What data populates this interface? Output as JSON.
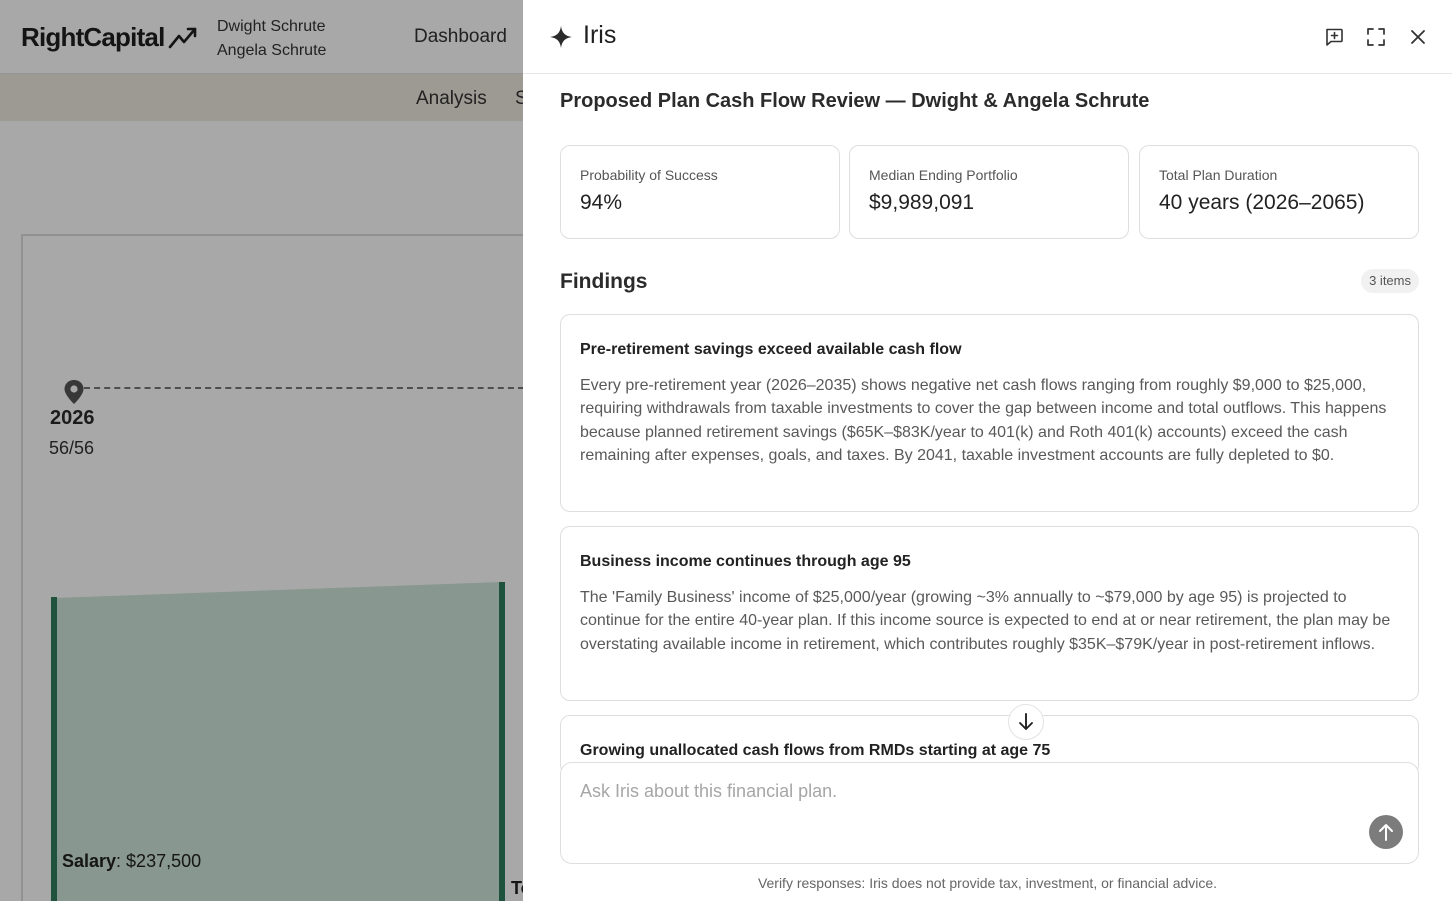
{
  "app": {
    "logo_text": "RightCapital",
    "client_names": [
      "Dwight Schrute",
      "Angela Schrute"
    ],
    "nav": {
      "dashboard": "Dashboard"
    },
    "subnav": {
      "analysis": "Analysis",
      "next_partial": "S"
    },
    "timeline": {
      "year": "2026",
      "ages": "56/56"
    },
    "chart": {
      "salary_label": "Salary",
      "salary_value": ": $237,500",
      "partial_label": "To"
    }
  },
  "drawer": {
    "title": "Iris",
    "review_title": "Proposed Plan Cash Flow Review — Dwight & Angela Schrute",
    "metrics": [
      {
        "label": "Probability of Success",
        "value": "94%"
      },
      {
        "label": "Median Ending Portfolio",
        "value": "$9,989,091"
      },
      {
        "label": "Total Plan Duration",
        "value": "40 years (2026–2065)"
      }
    ],
    "findings_title": "Findings",
    "findings_count": "3 items",
    "findings": [
      {
        "title": "Pre-retirement savings exceed available cash flow",
        "body": "Every pre-retirement year (2026–2035) shows negative net cash flows ranging from roughly $9,000 to $25,000, requiring withdrawals from taxable investments to cover the gap between income and total outflows. This happens because planned retirement savings ($65K–$83K/year to 401(k) and Roth 401(k) accounts) exceed the cash remaining after expenses, goals, and taxes. By 2041, taxable investment accounts are fully depleted to $0."
      },
      {
        "title": "Business income continues through age 95",
        "body": "The 'Family Business' income of $25,000/year (growing ~3% annually to ~$79,000 by age 95) is projected to continue for the entire 40-year plan. If this income source is expected to end at or near retirement, the plan may be overstating available income in retirement, which contributes roughly $35K–$79K/year in post-retirement inflows."
      },
      {
        "title": "Growing unallocated cash flows from RMDs starting at age 75",
        "body": ""
      }
    ],
    "input_placeholder": "Ask Iris about this financial plan.",
    "disclaimer": "Verify responses: Iris does not provide tax, investment, or financial advice.",
    "icons": {
      "title": "sparkle-icon",
      "new_chat": "new-chat-icon",
      "expand": "expand-icon",
      "close": "close-icon",
      "scroll": "arrow-down-icon",
      "send": "arrow-up-icon"
    }
  }
}
